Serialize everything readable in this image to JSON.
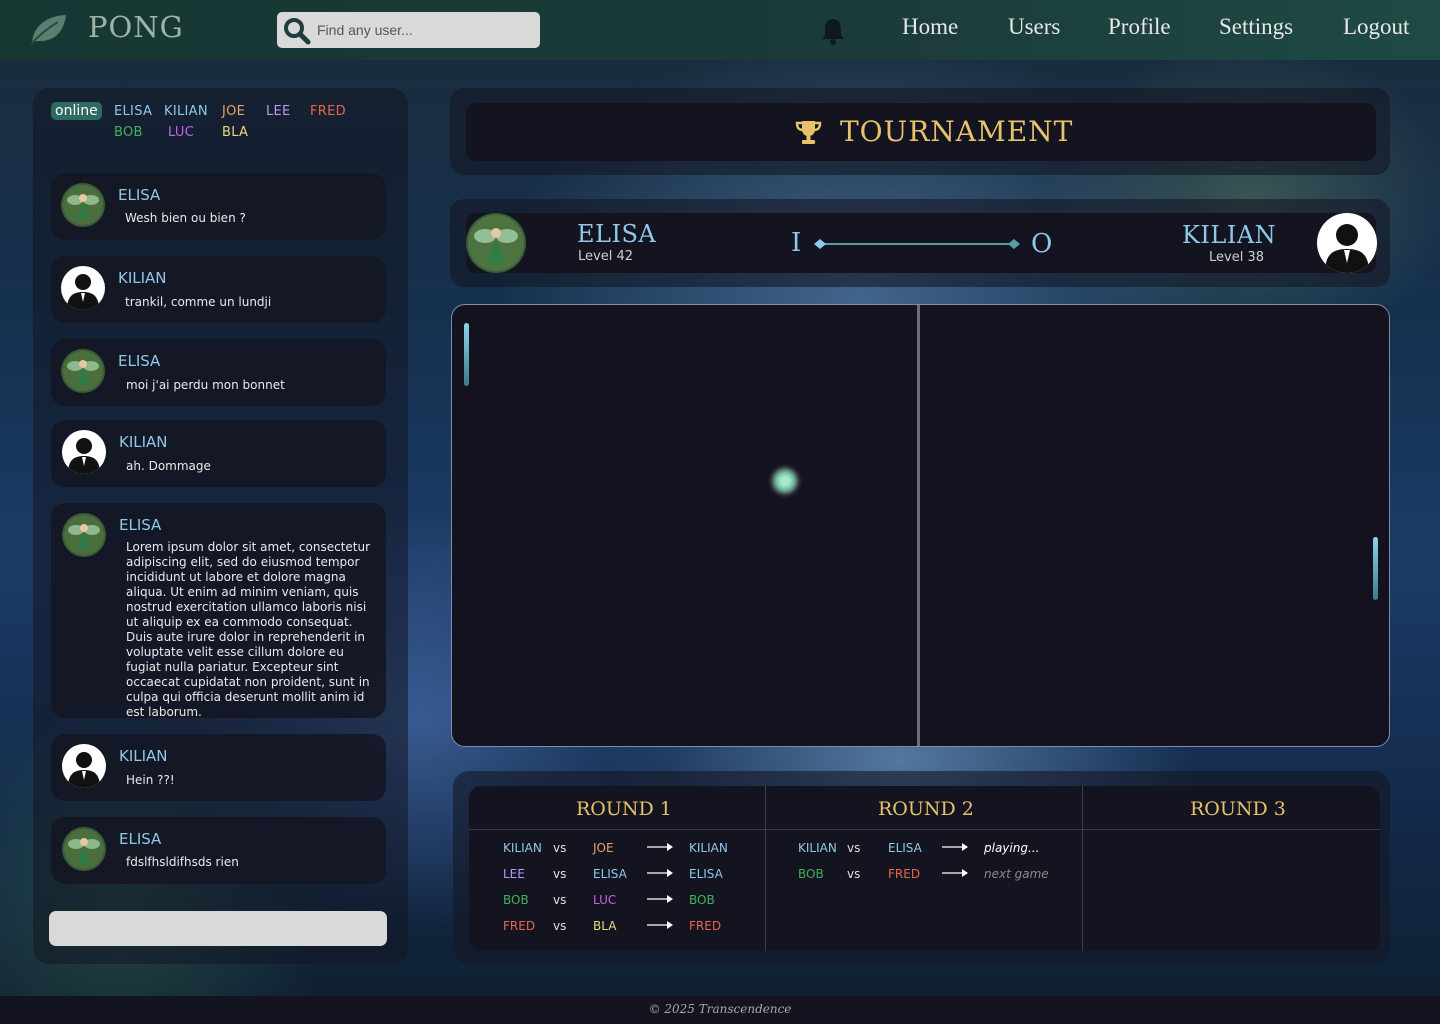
{
  "header": {
    "logo_text": "PONG",
    "search": {
      "placeholder": "Find any user..."
    },
    "nav": {
      "home": "Home",
      "users": "Users",
      "profile": "Profile",
      "settings": "Settings",
      "logout": "Logout"
    }
  },
  "colors": {
    "elisa": "#8fc9e8",
    "kilian": "#8fc9e8",
    "joe": "#e7a26b",
    "lee": "#b898f2",
    "fred": "#e8664b",
    "bob": "#3fb35a",
    "luc": "#c85ff0",
    "bla": "#e9d97a",
    "accent_gold": "#e7c26b"
  },
  "online": {
    "label": "online",
    "users": [
      {
        "name": "ELISA",
        "color": "#8fc9e8"
      },
      {
        "name": "KILIAN",
        "color": "#8fc9e8"
      },
      {
        "name": "JOE",
        "color": "#e7a26b"
      },
      {
        "name": "LEE",
        "color": "#b898f2"
      },
      {
        "name": "FRED",
        "color": "#e8664b"
      },
      {
        "name": "BOB",
        "color": "#3fb35a"
      },
      {
        "name": "LUC",
        "color": "#c85ff0"
      },
      {
        "name": "BLA",
        "color": "#e9d97a"
      }
    ]
  },
  "chat": {
    "messages": [
      {
        "author": "ELISA",
        "avatar": "fairy-avatar",
        "text": "Wesh bien ou bien ?"
      },
      {
        "author": "KILIAN",
        "avatar": "silhouette-avatar",
        "text": "trankil, comme un lundji"
      },
      {
        "author": "ELISA",
        "avatar": "fairy-avatar",
        "text": "moi j'ai perdu mon bonnet"
      },
      {
        "author": "KILIAN",
        "avatar": "silhouette-avatar",
        "text": "ah. Dommage"
      },
      {
        "author": "ELISA",
        "avatar": "fairy-avatar",
        "text": "Lorem ipsum dolor sit amet, consectetur adipiscing elit, sed do eiusmod tempor incididunt ut labore et dolore magna aliqua. Ut enim ad minim veniam, quis nostrud exercitation ullamco laboris nisi ut aliquip ex ea commodo consequat. Duis aute irure dolor in reprehenderit in voluptate velit esse cillum dolore eu fugiat nulla pariatur. Excepteur sint occaecat cupidatat non proident, sunt in culpa qui officia deserunt mollit anim id est laborum."
      },
      {
        "author": "KILIAN",
        "avatar": "silhouette-avatar",
        "text": "Hein ??!"
      },
      {
        "author": "ELISA",
        "avatar": "fairy-avatar",
        "text": "fdslfhsldifhsds rien"
      }
    ]
  },
  "tournament": {
    "title": "TOURNAMENT"
  },
  "match": {
    "left": {
      "name": "ELISA",
      "level": "Level 42",
      "score": "I"
    },
    "right": {
      "name": "KILIAN",
      "level": "Level 38",
      "score": "O"
    }
  },
  "bracket": {
    "rounds": [
      {
        "title": "ROUND 1",
        "matches": [
          {
            "p1": "KILIAN",
            "p1_color": "#8fc9e8",
            "p2": "JOE",
            "p2_color": "#e7a26b",
            "result": "KILIAN",
            "result_color": "#8fc9e8"
          },
          {
            "p1": "LEE",
            "p1_color": "#b898f2",
            "p2": "ELISA",
            "p2_color": "#8fc9e8",
            "result": "ELISA",
            "result_color": "#8fc9e8"
          },
          {
            "p1": "BOB",
            "p1_color": "#3fb35a",
            "p2": "LUC",
            "p2_color": "#c85ff0",
            "result": "BOB",
            "result_color": "#3fb35a"
          },
          {
            "p1": "FRED",
            "p1_color": "#e8664b",
            "p2": "BLA",
            "p2_color": "#e9d97a",
            "result": "FRED",
            "result_color": "#e8664b"
          }
        ]
      },
      {
        "title": "ROUND 2",
        "matches": [
          {
            "p1": "KILIAN",
            "p1_color": "#8fc9e8",
            "p2": "ELISA",
            "p2_color": "#8fc9e8",
            "result": "playing...",
            "result_color": "#ffffff"
          },
          {
            "p1": "BOB",
            "p1_color": "#3fb35a",
            "p2": "FRED",
            "p2_color": "#e8664b",
            "result": "next game",
            "result_color": "#8a8a8a"
          }
        ]
      },
      {
        "title": "ROUND 3",
        "matches": []
      }
    ],
    "vs_label": "vs"
  },
  "footer": {
    "text": "© 2025 Transcendence"
  }
}
